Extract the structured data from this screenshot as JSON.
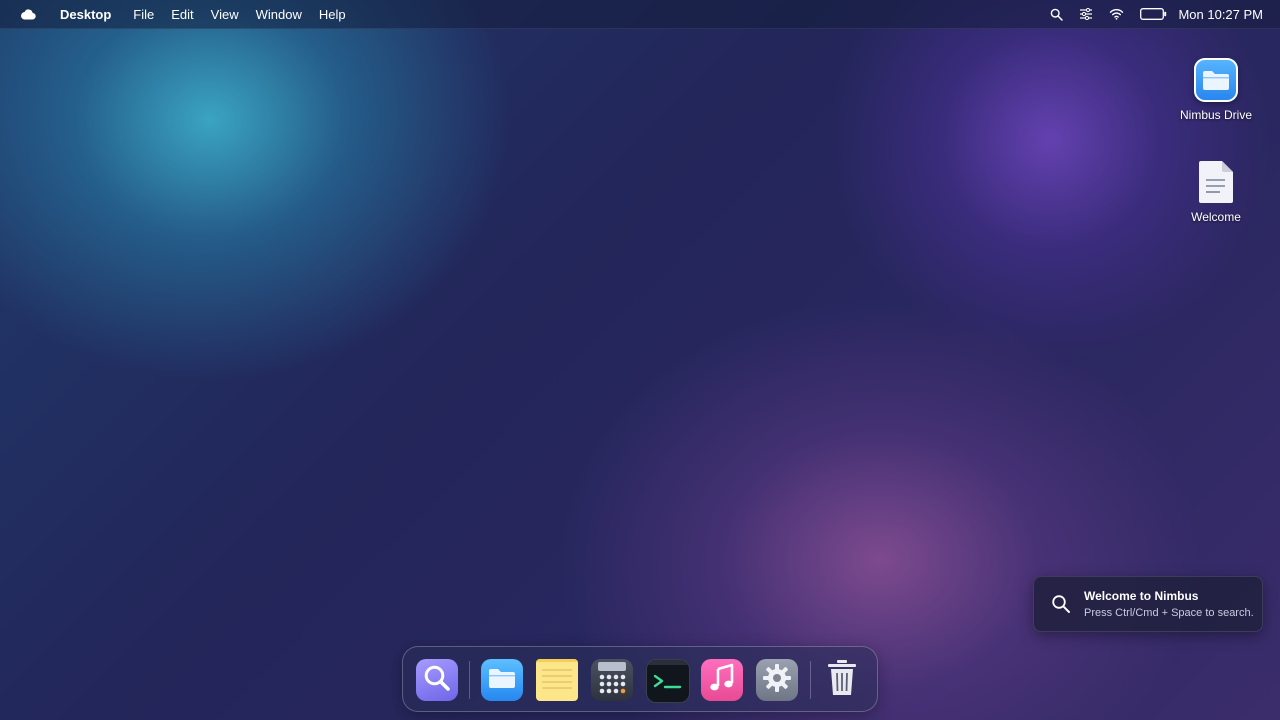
{
  "menubar": {
    "app_name": "Desktop",
    "menus": [
      "File",
      "Edit",
      "View",
      "Window",
      "Help"
    ],
    "clock": "Mon 10:27 PM",
    "status_icons": [
      "search-icon",
      "control-center-icon",
      "wifi-icon",
      "battery-icon"
    ]
  },
  "desktop_icons": [
    {
      "label": "Nimbus Drive",
      "icon": "folder-icon"
    },
    {
      "label": "Welcome",
      "icon": "document-icon"
    }
  ],
  "toast": {
    "title": "Welcome to Nimbus",
    "body": "Press Ctrl/Cmd + Space to search."
  },
  "dock": {
    "items": [
      "search-app",
      "files-app",
      "notes-app",
      "calculator-app",
      "terminal-app",
      "music-app",
      "settings-app",
      "trash"
    ]
  },
  "colors": {
    "accent_blue": "#2684ee",
    "search_purple": "#8a7cf0",
    "music_pink": "#f25aa8",
    "notes_yellow": "#fde58a",
    "terminal_green": "#3ddc97"
  }
}
